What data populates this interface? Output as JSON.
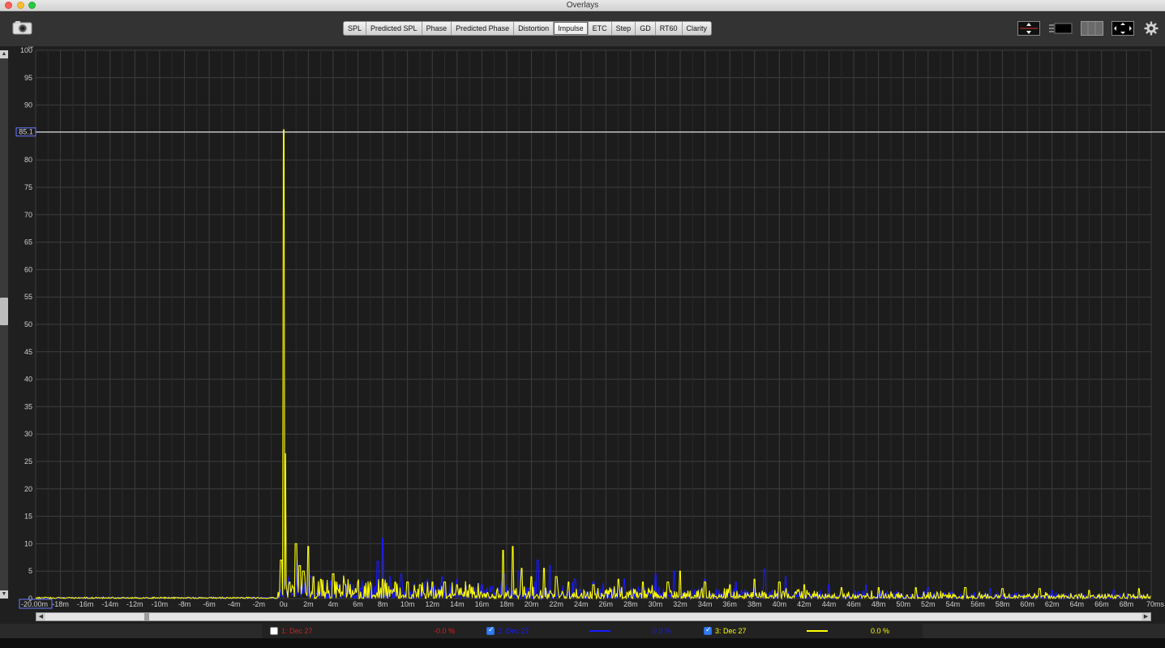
{
  "window": {
    "title": "Overlays"
  },
  "toolbar": {
    "tabs": [
      "SPL",
      "Predicted SPL",
      "Phase",
      "Predicted Phase",
      "Distortion",
      "Impulse",
      "ETC",
      "Step",
      "GD",
      "RT60",
      "Clarity"
    ],
    "active_tab": "Impulse"
  },
  "chart_data": {
    "type": "line",
    "xlabel": "",
    "ylabel": "%",
    "xlim": [
      -20,
      70
    ],
    "xunit": "ms",
    "ylim": [
      0,
      100
    ],
    "y_ticks": [
      0,
      5,
      10,
      15,
      20,
      25,
      30,
      35,
      40,
      45,
      50,
      55,
      60,
      65,
      70,
      75,
      80,
      85,
      90,
      95,
      100
    ],
    "x_tick_labels": [
      "-20.00m",
      "-18m",
      "-16m",
      "-14m",
      "-12m",
      "-10m",
      "-8m",
      "-6m",
      "-4m",
      "-2m",
      "0u",
      "2m",
      "4m",
      "6m",
      "8m",
      "10m",
      "12m",
      "14m",
      "16m",
      "18m",
      "20m",
      "22m",
      "24m",
      "26m",
      "28m",
      "30m",
      "32m",
      "34m",
      "36m",
      "38m",
      "40m",
      "42m",
      "44m",
      "46m",
      "48m",
      "50m",
      "52m",
      "54m",
      "56m",
      "58m",
      "60m",
      "62m",
      "64m",
      "66m",
      "68m",
      "70ms"
    ],
    "grid": true,
    "cursor_y": {
      "value": 85.1,
      "label": "85.1"
    },
    "series": [
      {
        "name": "2: Dec 27",
        "color": "#1a1aff",
        "peaks": [
          [
            1.1,
            6.5
          ],
          [
            2.2,
            4.0
          ],
          [
            3.8,
            3.2
          ],
          [
            7.6,
            6.8
          ],
          [
            8.0,
            11.0
          ],
          [
            8.6,
            4.0
          ],
          [
            9.5,
            4.5
          ],
          [
            11.5,
            3.0
          ],
          [
            12.8,
            4.0
          ],
          [
            14.0,
            3.5
          ],
          [
            16.0,
            2.5
          ],
          [
            17.8,
            4.5
          ],
          [
            19.0,
            5.0
          ],
          [
            20.5,
            7.0
          ],
          [
            21.5,
            6.0
          ],
          [
            23.5,
            3.5
          ],
          [
            25.0,
            3.0
          ],
          [
            27.5,
            3.5
          ],
          [
            30.0,
            4.5
          ],
          [
            31.5,
            5.0
          ],
          [
            34.0,
            3.5
          ],
          [
            36.5,
            3.0
          ],
          [
            38.8,
            5.3
          ],
          [
            40.5,
            4.0
          ],
          [
            44.0,
            2.5
          ],
          [
            47.0,
            2.5
          ],
          [
            52.0,
            2.0
          ],
          [
            57.0,
            1.8
          ],
          [
            62.0,
            1.5
          ],
          [
            67.0,
            1.5
          ]
        ]
      },
      {
        "name": "3: Dec 27",
        "color": "#ffff00",
        "peaks": [
          [
            -0.2,
            7.0
          ],
          [
            0.0,
            85.5
          ],
          [
            0.15,
            26.5
          ],
          [
            0.5,
            3.0
          ],
          [
            1.0,
            10.0
          ],
          [
            1.3,
            6.0
          ],
          [
            1.6,
            5.0
          ],
          [
            2.0,
            9.5
          ],
          [
            2.4,
            4.0
          ],
          [
            3.0,
            3.5
          ],
          [
            4.0,
            4.5
          ],
          [
            5.0,
            2.5
          ],
          [
            6.0,
            3.0
          ],
          [
            7.0,
            2.5
          ],
          [
            8.0,
            3.5
          ],
          [
            9.0,
            3.0
          ],
          [
            10.0,
            3.0
          ],
          [
            11.0,
            2.5
          ],
          [
            12.0,
            3.0
          ],
          [
            13.0,
            3.0
          ],
          [
            14.0,
            2.5
          ],
          [
            15.0,
            2.5
          ],
          [
            17.7,
            8.8
          ],
          [
            18.5,
            9.5
          ],
          [
            19.2,
            5.5
          ],
          [
            20.0,
            4.0
          ],
          [
            21.0,
            5.5
          ],
          [
            22.0,
            4.0
          ],
          [
            23.0,
            3.0
          ],
          [
            25.0,
            2.5
          ],
          [
            27.0,
            3.5
          ],
          [
            29.0,
            3.0
          ],
          [
            31.0,
            3.0
          ],
          [
            32.0,
            5.0
          ],
          [
            34.0,
            3.0
          ],
          [
            36.0,
            2.5
          ],
          [
            38.0,
            3.5
          ],
          [
            40.0,
            3.0
          ],
          [
            42.0,
            2.5
          ],
          [
            45.0,
            2.0
          ],
          [
            48.0,
            2.0
          ],
          [
            51.0,
            2.0
          ],
          [
            55.0,
            2.0
          ],
          [
            58.0,
            1.8
          ],
          [
            61.0,
            1.8
          ],
          [
            65.0,
            1.5
          ],
          [
            69.0,
            1.8
          ]
        ]
      }
    ]
  },
  "legend": {
    "items": [
      {
        "label": "1: Dec 27",
        "checked": false,
        "color": "#cc2222",
        "value": "-0.0 %"
      },
      {
        "label": "2: Dec 27",
        "checked": true,
        "color": "#1a1aff",
        "value": "0.0 %"
      },
      {
        "label": "3: Dec 27",
        "checked": true,
        "color": "#ffff00",
        "value": "0.0 %"
      }
    ]
  },
  "icons": [
    "camera-icon",
    "vertical-zoom-icon",
    "display-mode-icon",
    "overlay-panel-icon",
    "fit-view-icon",
    "gear-icon"
  ]
}
